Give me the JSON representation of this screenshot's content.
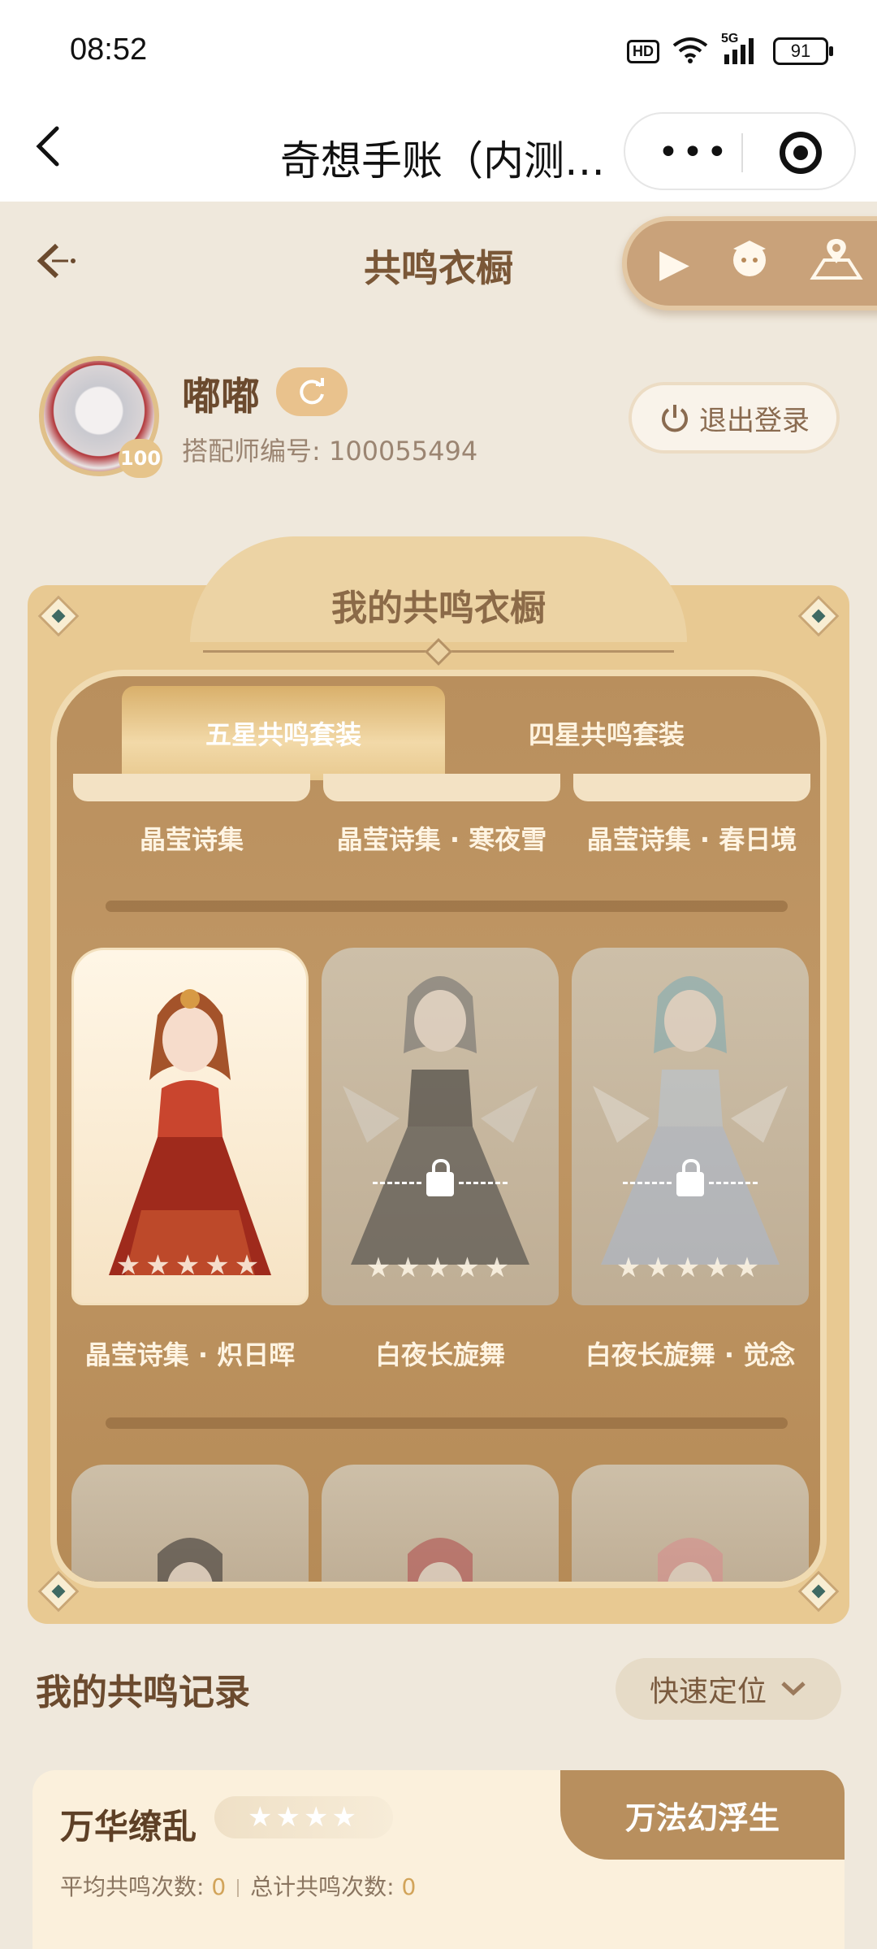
{
  "status_bar": {
    "time": "08:52",
    "hd": "HD",
    "network": "5G",
    "battery": "91"
  },
  "navbar": {
    "title": "奇想手账（内测…",
    "menu_glyph": "•••"
  },
  "header": {
    "title": "共鸣衣橱",
    "tools": [
      "play-icon",
      "mascot-icon",
      "map-icon"
    ]
  },
  "profile": {
    "name": "嘟嘟",
    "level": "100",
    "id_label": "搭配师编号: 100055494",
    "logout_label": "退出登录"
  },
  "wardrobe": {
    "title": "我的共鸣衣橱",
    "tabs": [
      {
        "label": "五星共鸣套装",
        "active": true
      },
      {
        "label": "四星共鸣套装",
        "active": false
      }
    ],
    "row1_labels": [
      "晶莹诗集",
      "晶莹诗集 · 寒夜雪",
      "晶莹诗集 · 春日境"
    ],
    "row2": [
      {
        "label": "晶莹诗集 · 炽日晖",
        "locked": false,
        "stars": "★★★★★"
      },
      {
        "label": "白夜长旋舞",
        "locked": true,
        "stars": "★★★★★"
      },
      {
        "label": "白夜长旋舞 · 觉念",
        "locked": true,
        "stars": "★★★★★"
      }
    ]
  },
  "records": {
    "title": "我的共鸣记录",
    "locate_label": "快速定位",
    "card": {
      "name": "万华缭乱",
      "stars": "★★★★",
      "tab_label": "万法幻浮生",
      "avg_label": "平均共鸣次数: ",
      "avg_value": "0",
      "total_label": "总计共鸣次数: ",
      "total_value": "0"
    }
  },
  "colors": {
    "background": "#efe8dc",
    "panel": "#e8c992",
    "wood": "#bf9562",
    "text_brown": "#6b4a2e",
    "accent_gold": "#d2a45a"
  }
}
